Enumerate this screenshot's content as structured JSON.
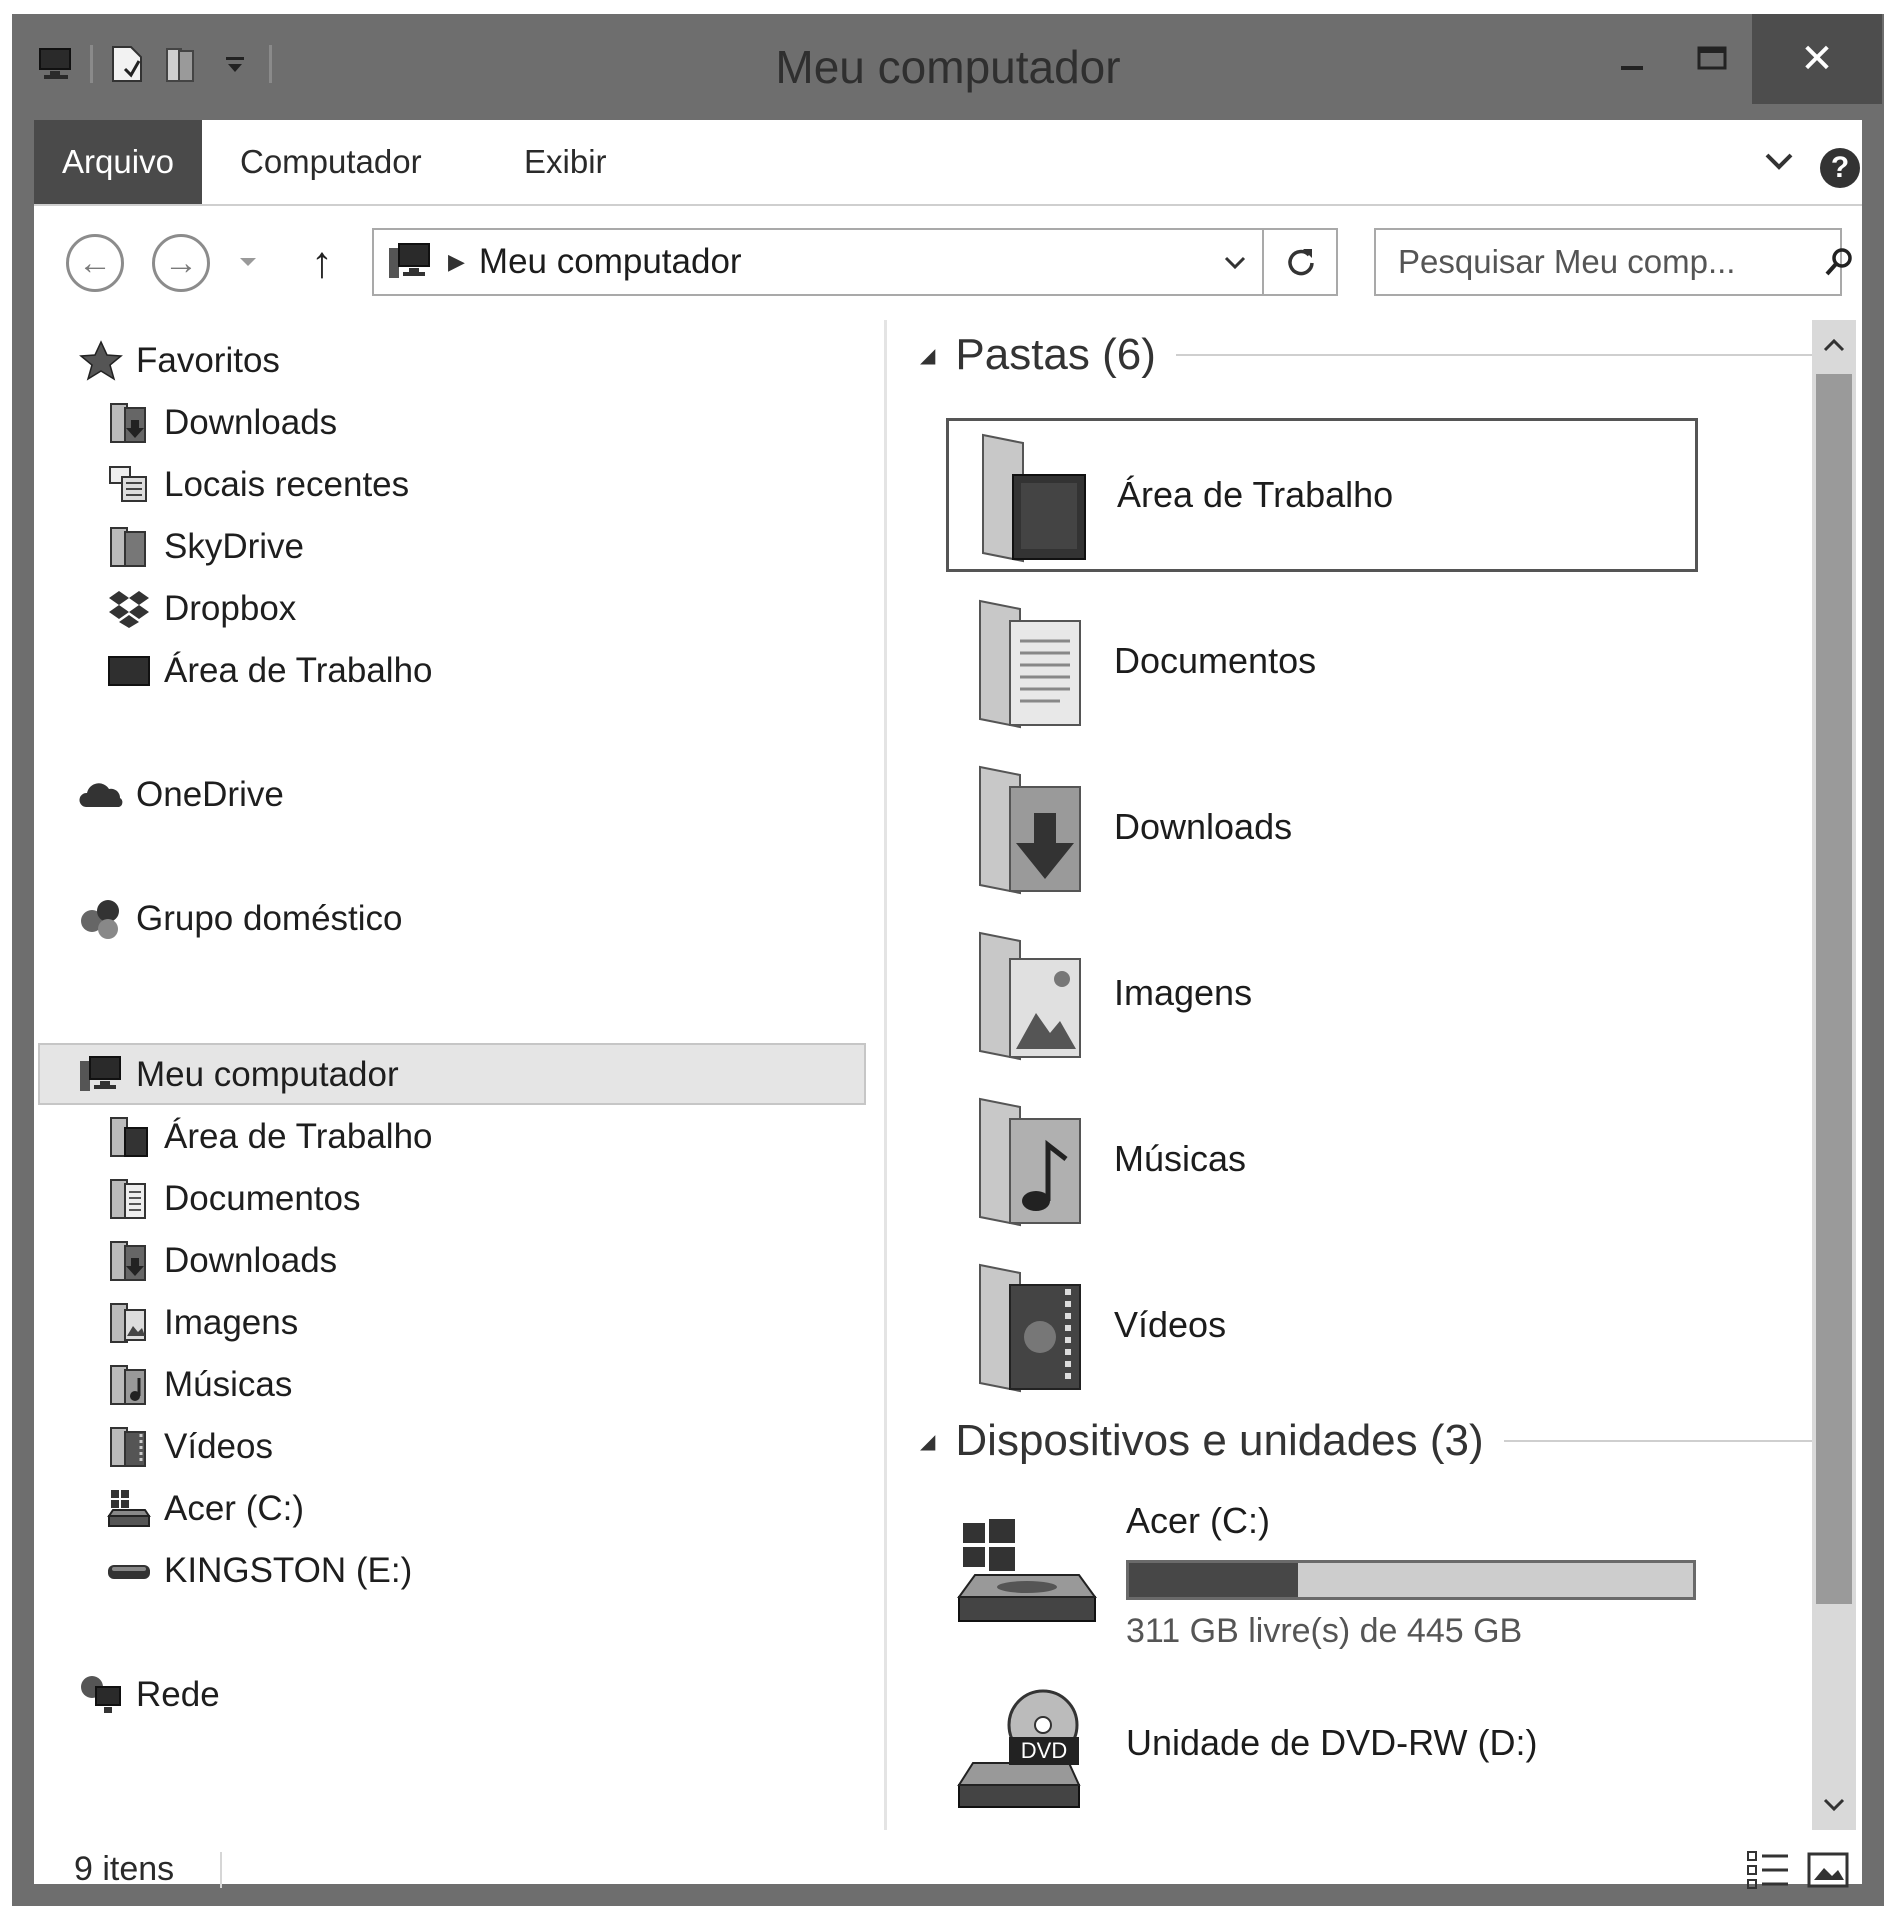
{
  "window": {
    "title": "Meu computador"
  },
  "titlebar": {
    "close_glyph": "✕"
  },
  "ribbon": {
    "tabs": [
      {
        "label": "Arquivo"
      },
      {
        "label": "Computador"
      },
      {
        "label": "Exibir"
      }
    ],
    "help_glyph": "?"
  },
  "navbar": {
    "back_glyph": "←",
    "forward_glyph": "→",
    "up_glyph": "↑",
    "address": {
      "path": "Meu computador",
      "separator": "▶"
    },
    "search": {
      "placeholder": "Pesquisar Meu comp..."
    }
  },
  "navpane": {
    "favorites": {
      "label": "Favoritos",
      "items": [
        {
          "label": "Downloads",
          "icon": "downloads-folder-icon"
        },
        {
          "label": "Locais recentes",
          "icon": "recent-places-icon"
        },
        {
          "label": "SkyDrive",
          "icon": "skydrive-folder-icon"
        },
        {
          "label": "Dropbox",
          "icon": "dropbox-icon"
        },
        {
          "label": "Área de Trabalho",
          "icon": "desktop-icon"
        }
      ]
    },
    "onedrive": {
      "label": "OneDrive"
    },
    "homegroup": {
      "label": "Grupo doméstico"
    },
    "computer": {
      "label": "Meu computador",
      "items": [
        {
          "label": "Área de Trabalho",
          "icon": "desktop-folder-icon"
        },
        {
          "label": "Documentos",
          "icon": "documents-folder-icon"
        },
        {
          "label": "Downloads",
          "icon": "downloads-folder-icon"
        },
        {
          "label": "Imagens",
          "icon": "pictures-folder-icon"
        },
        {
          "label": "Músicas",
          "icon": "music-folder-icon"
        },
        {
          "label": "Vídeos",
          "icon": "videos-folder-icon"
        },
        {
          "label": "Acer (C:)",
          "icon": "hard-drive-icon"
        },
        {
          "label": "KINGSTON (E:)",
          "icon": "usb-drive-icon"
        }
      ]
    },
    "network": {
      "label": "Rede"
    }
  },
  "content": {
    "folders_group": {
      "title": "Pastas (6)",
      "items": [
        {
          "label": "Área de Trabalho",
          "icon": "desktop-folder-icon",
          "selected": true
        },
        {
          "label": "Documentos",
          "icon": "documents-folder-icon"
        },
        {
          "label": "Downloads",
          "icon": "downloads-folder-icon"
        },
        {
          "label": "Imagens",
          "icon": "pictures-folder-icon"
        },
        {
          "label": "Músicas",
          "icon": "music-folder-icon"
        },
        {
          "label": "Vídeos",
          "icon": "videos-folder-icon"
        }
      ]
    },
    "devices_group": {
      "title": "Dispositivos e unidades (3)",
      "items": [
        {
          "label": "Acer (C:)",
          "free_text": "311 GB livre(s) de 445 GB",
          "used_fraction": 0.3,
          "icon": "windows-hard-drive-icon"
        },
        {
          "label": "Unidade de DVD-RW (D:)",
          "icon": "dvd-drive-icon",
          "badge": "DVD"
        }
      ]
    }
  },
  "statusbar": {
    "count": "9 itens"
  },
  "colors": {
    "titlebar": "#6e6e6e",
    "file_tab": "#4a4a4a",
    "selection": "#e5e5e5",
    "drive_fill": "#474747",
    "drive_bar": "#cdcdcd"
  }
}
